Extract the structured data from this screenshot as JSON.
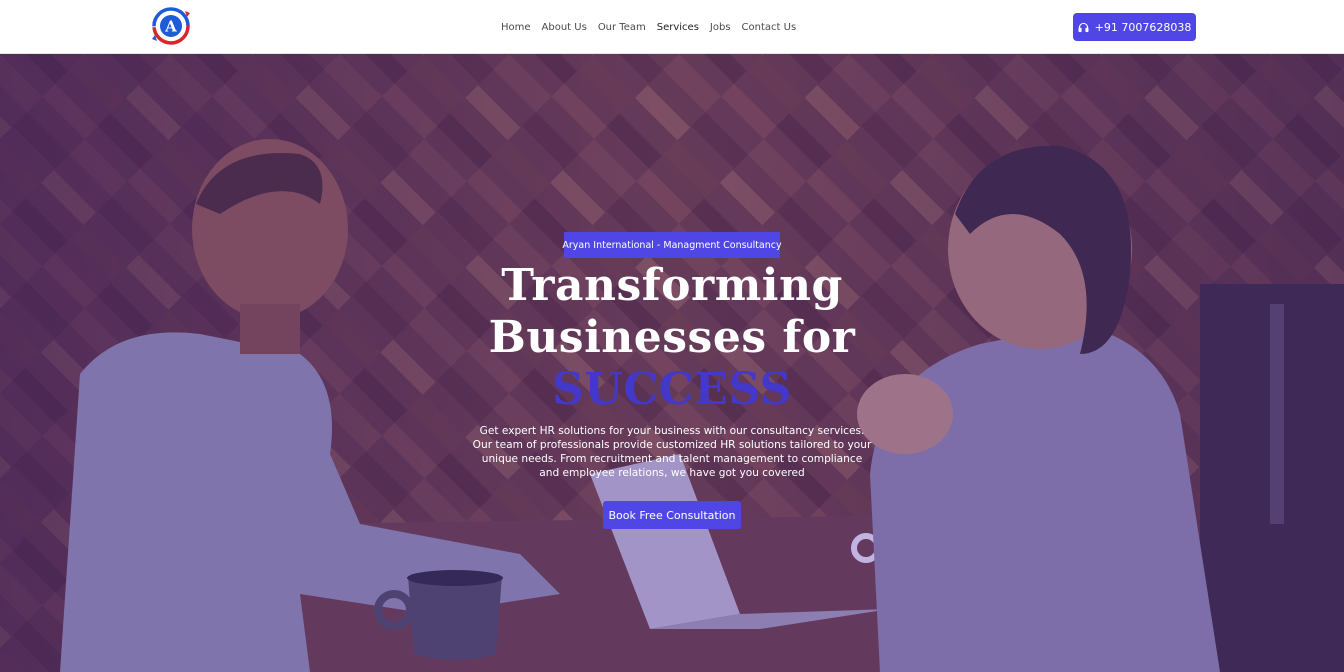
{
  "brand": {
    "logo_letter": "A"
  },
  "nav": {
    "items": [
      {
        "label": "Home"
      },
      {
        "label": "About Us"
      },
      {
        "label": "Our Team"
      },
      {
        "label": "Services"
      },
      {
        "label": "Jobs"
      },
      {
        "label": "Contact Us"
      }
    ]
  },
  "header": {
    "phone": "+91 7007628038",
    "phone_icon": "headphones-icon"
  },
  "hero": {
    "badge": "Aryan International - Managment Consultancy",
    "headline_line1": "Transforming",
    "headline_line2": "Businesses for",
    "headline_accent": "SUCCESS",
    "description": "Get expert HR solutions for your business with our consultancy services. Our team of professionals provide customized HR solutions tailored to your unique needs. From recruitment and talent management to compliance and employee relations, we have got you covered",
    "cta_label": "Book Free Consultation"
  },
  "colors": {
    "accent": "#4f46e5",
    "headline_accent": "#4338ca",
    "logo_red": "#d62828",
    "logo_blue": "#1e5bd8"
  }
}
